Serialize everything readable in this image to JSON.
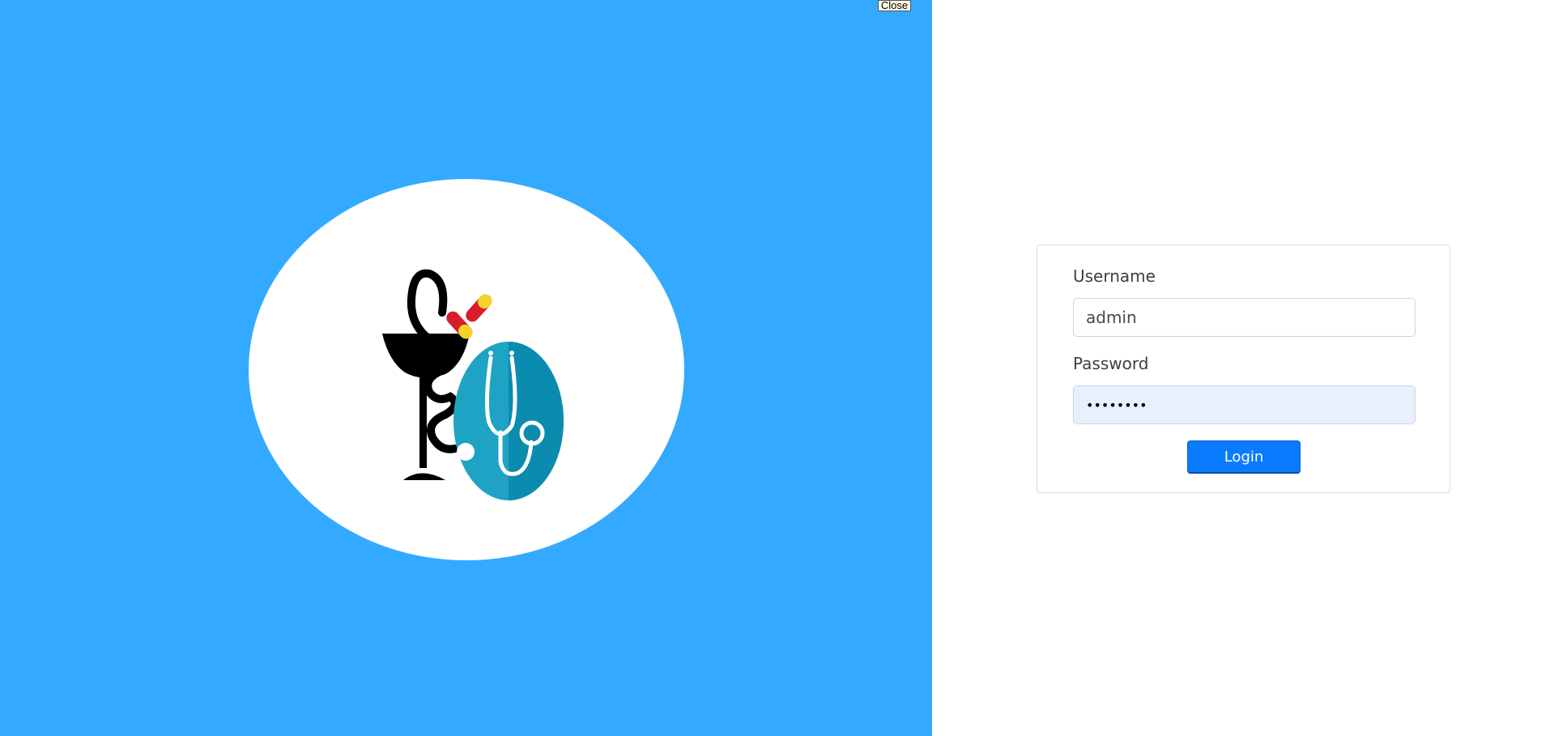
{
  "close_button": {
    "label": "Close"
  },
  "logo": {
    "icon": "pharmacy-medical-logo"
  },
  "login_form": {
    "username_label": "Username",
    "username_value": "admin",
    "password_label": "Password",
    "password_value": "12345678",
    "login_label": "Login"
  },
  "colors": {
    "left_panel_bg": "#33aaff",
    "login_button": "#0a7bff",
    "password_autofill_bg": "#e8f0fe"
  }
}
